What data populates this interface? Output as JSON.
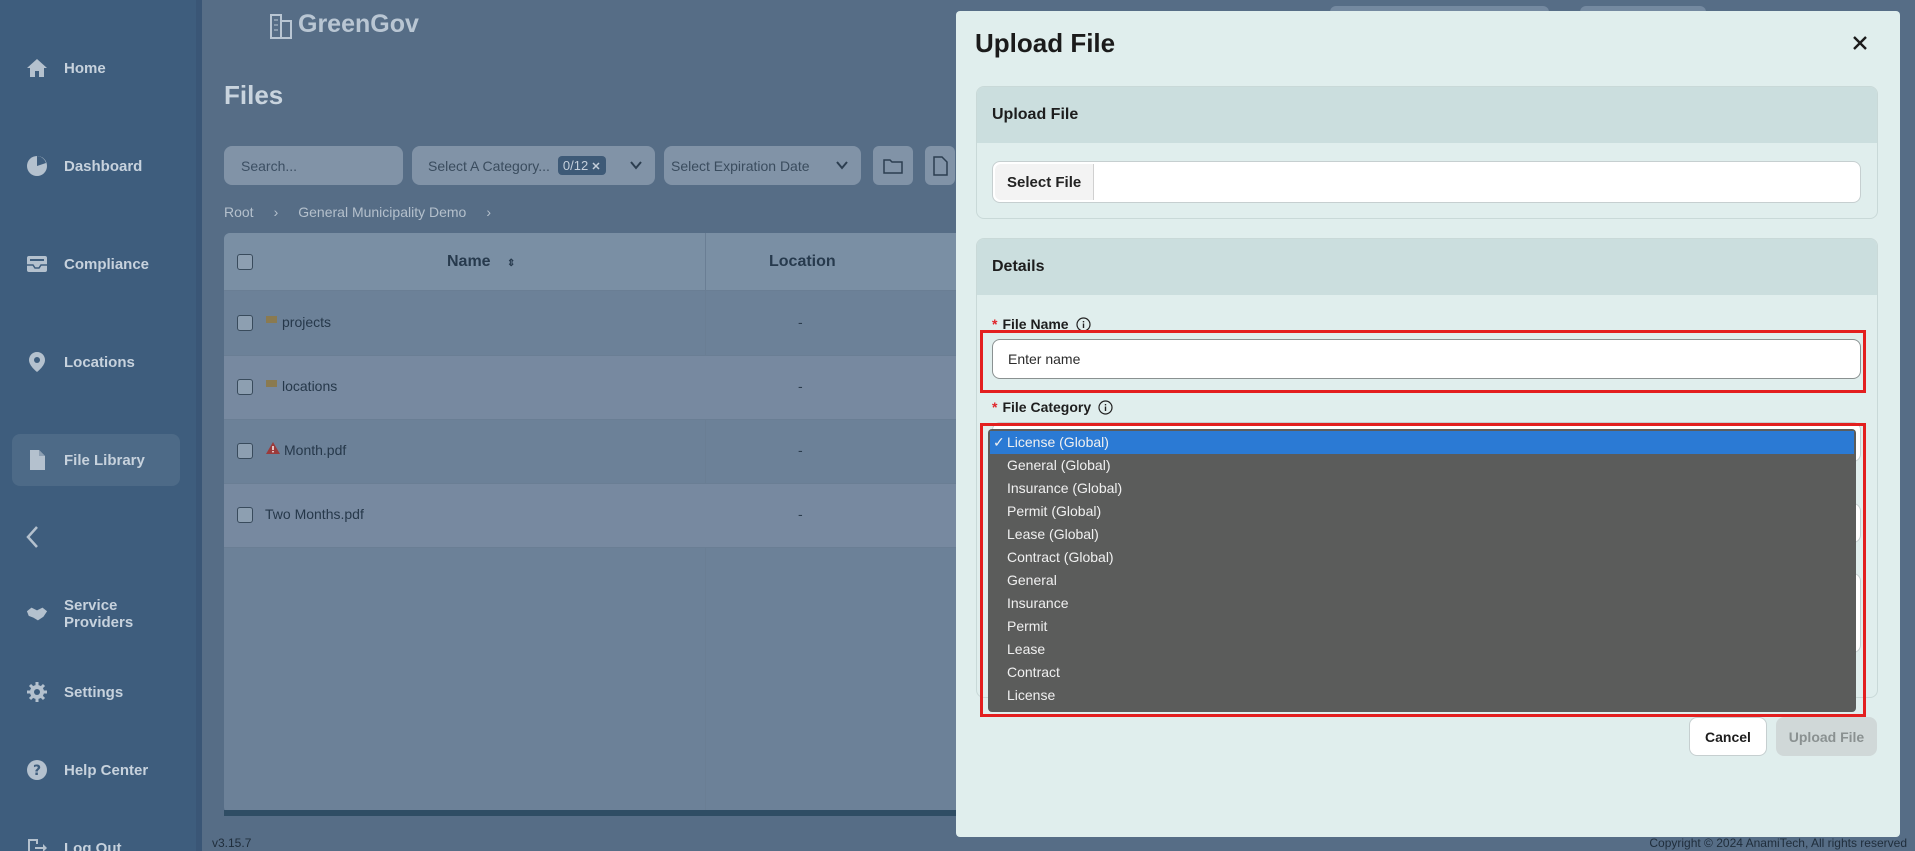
{
  "app": {
    "logo_text": "GreenGov",
    "version": "v3.15.7",
    "copyright": "Copyright © 2024 AnamiTech, All rights reserved"
  },
  "sidebar": {
    "items": [
      {
        "label": "Home",
        "icon": "home-icon"
      },
      {
        "label": "Dashboard",
        "icon": "dashboard-icon"
      },
      {
        "label": "Compliance",
        "icon": "inbox-icon"
      },
      {
        "label": "Locations",
        "icon": "location-pin-icon"
      },
      {
        "label": "File Library",
        "icon": "file-icon",
        "active": true
      },
      {
        "label": "Service Providers",
        "icon": "handshake-icon"
      },
      {
        "label": "Settings",
        "icon": "gear-icon"
      },
      {
        "label": "Help Center",
        "icon": "help-icon"
      },
      {
        "label": "Log Out",
        "icon": "logout-icon"
      }
    ]
  },
  "page": {
    "title": "Files",
    "search_placeholder": "Search...",
    "category_select": {
      "label": "Select A Category...",
      "badge": "0/12"
    },
    "expiration_select": {
      "label": "Select Expiration Date"
    },
    "breadcrumb": [
      "Root",
      "General Municipality Demo"
    ]
  },
  "table": {
    "columns": [
      "Name",
      "Location"
    ],
    "rows": [
      {
        "name": "projects",
        "type": "folder",
        "location": "-"
      },
      {
        "name": "locations",
        "type": "folder",
        "location": "-"
      },
      {
        "name": "Month.pdf",
        "type": "warning",
        "location": "-"
      },
      {
        "name": "Two Months.pdf",
        "type": "file",
        "location": "-"
      }
    ]
  },
  "modal": {
    "title": "Upload File",
    "upload_section": {
      "title": "Upload File",
      "select_button": "Select File"
    },
    "details_section": {
      "title": "Details",
      "file_name_label": "File Name",
      "file_name_placeholder": "Enter name",
      "file_category_label": "File Category"
    },
    "category_options": [
      "License (Global)",
      "General (Global)",
      "Insurance (Global)",
      "Permit (Global)",
      "Lease (Global)",
      "Contract (Global)",
      "General",
      "Insurance",
      "Permit",
      "Lease",
      "Contract",
      "License"
    ],
    "selected_option": "License (Global)",
    "cancel_label": "Cancel",
    "upload_label": "Upload File"
  },
  "colors": {
    "accent": "#2b7ad4",
    "highlight": "#e31f1f",
    "required": "#e0242a"
  }
}
